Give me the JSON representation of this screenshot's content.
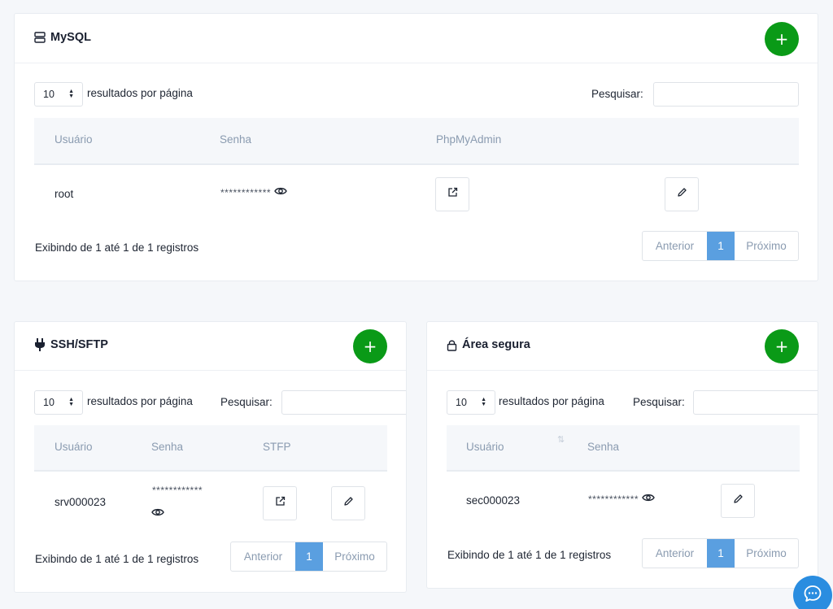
{
  "mysql": {
    "title": "MySQL",
    "length_value": "10",
    "length_label": "resultados por página",
    "search_label": "Pesquisar:",
    "search_value": "",
    "columns": [
      "Usuário",
      "Senha",
      "PhpMyAdmin"
    ],
    "rows": [
      {
        "user": "root",
        "password": "************"
      }
    ],
    "info": "Exibindo de 1 até 1 de 1 registros",
    "prev": "Anterior",
    "page": "1",
    "next": "Próximo"
  },
  "ssh": {
    "title": "SSH/SFTP",
    "length_value": "10",
    "length_label": "resultados por página",
    "search_label": "Pesquisar:",
    "search_value": "",
    "columns": [
      "Usuário",
      "Senha",
      "STFP"
    ],
    "rows": [
      {
        "user": "srv000023",
        "password": "************"
      }
    ],
    "info": "Exibindo de 1 até 1 de 1 registros",
    "prev": "Anterior",
    "page": "1",
    "next": "Próximo"
  },
  "secure": {
    "title": "Área segura",
    "length_value": "10",
    "length_label": "resultados por página",
    "search_label": "Pesquisar:",
    "search_value": "",
    "columns": [
      "Usuário",
      "Senha"
    ],
    "rows": [
      {
        "user": "sec000023",
        "password": "************"
      }
    ],
    "info": "Exibindo de 1 até 1 de 1 registros",
    "prev": "Anterior",
    "page": "1",
    "next": "Próximo"
  },
  "add_symbol": "+",
  "colors": {
    "add_button": "#0a9a17",
    "page_active": "#5a9fe0",
    "chat_button": "#2a8de0"
  },
  "icons": [
    "database-icon",
    "plug-icon",
    "lock-icon",
    "external-link-icon",
    "pencil-icon",
    "eye-icon",
    "chat-icon",
    "sort-icon"
  ]
}
